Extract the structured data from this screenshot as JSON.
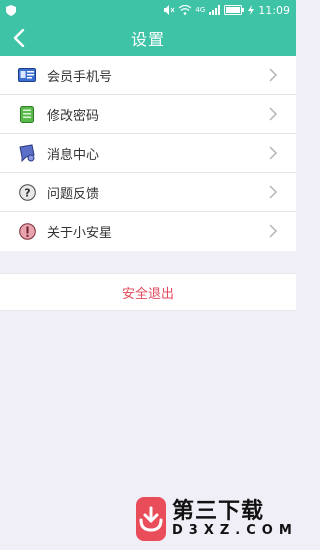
{
  "status_bar": {
    "network": "4G",
    "time": "11:09"
  },
  "header": {
    "title": "设置"
  },
  "menu": [
    {
      "label": "会员手机号",
      "icon": "id-card-icon"
    },
    {
      "label": "修改密码",
      "icon": "password-icon"
    },
    {
      "label": "消息中心",
      "icon": "message-icon"
    },
    {
      "label": "问题反馈",
      "icon": "question-icon"
    },
    {
      "label": "关于小安星",
      "icon": "info-icon"
    }
  ],
  "logout": {
    "label": "安全退出"
  },
  "watermark": {
    "main": "第三下载",
    "sub": "D3XZ.COM"
  },
  "colors": {
    "header_bg": "#3fc3a7",
    "logout_text": "#e34a5c",
    "page_bg": "#f0eef6"
  }
}
